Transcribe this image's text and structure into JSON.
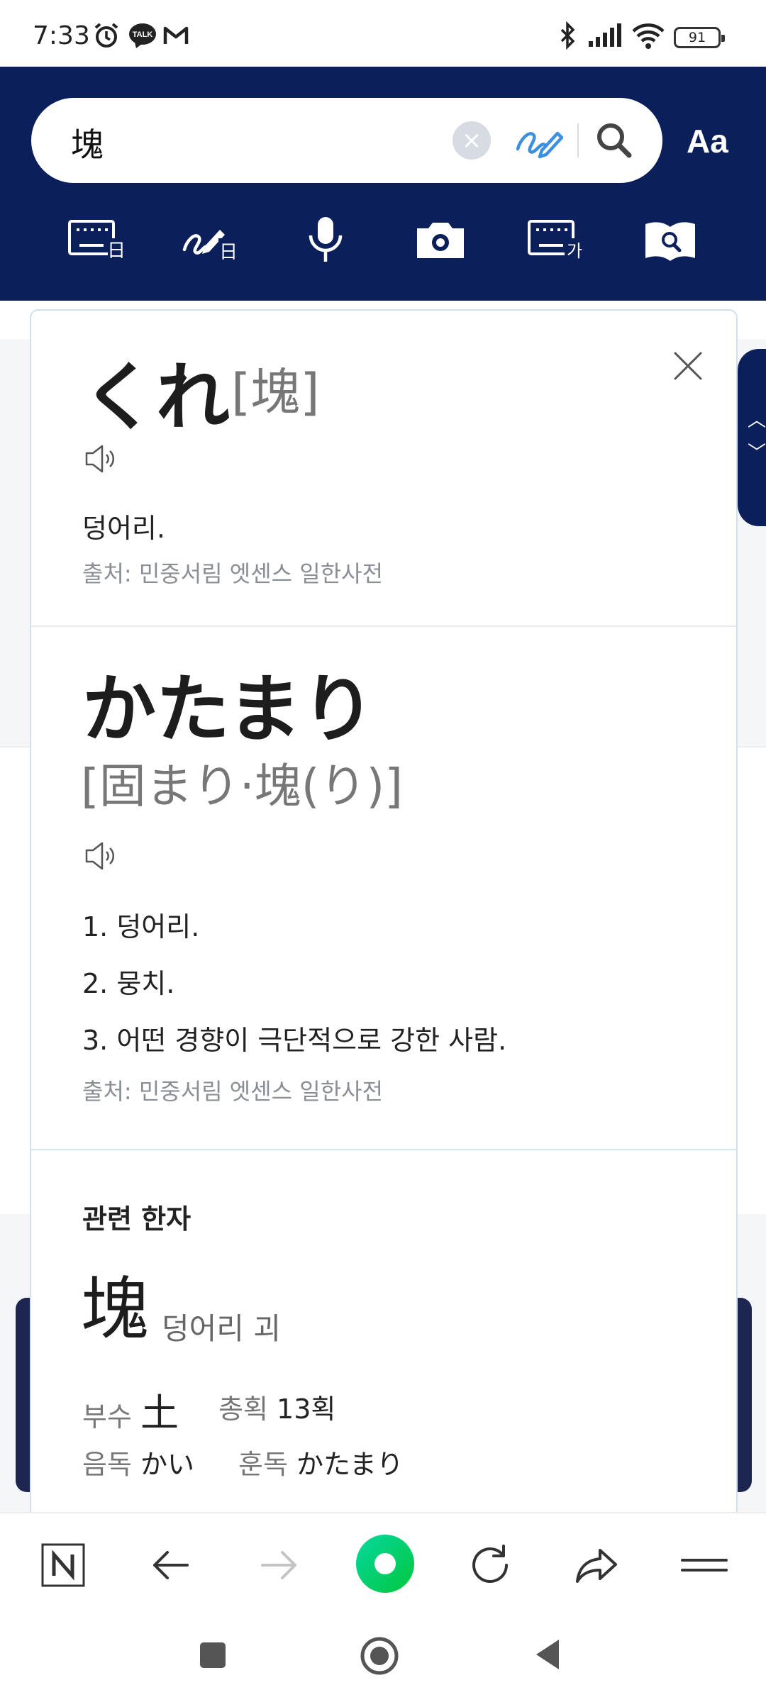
{
  "status_bar": {
    "time": "7:33",
    "battery": "91"
  },
  "search": {
    "query": "塊",
    "font_button": "Aa"
  },
  "entries": [
    {
      "headword": "くれ",
      "kanji": "[塊]",
      "definition": "덩어리.",
      "source": "출처: 민중서림 엣센스 일한사전"
    },
    {
      "headword": "かたまり",
      "kanji": "[固まり·塊(り)]",
      "definitions": [
        "1. 덩어리.",
        "2. 뭉치.",
        "3. 어떤 경향이 극단적으로 강한 사람."
      ],
      "source": "출처: 민중서림 엣센스 일한사전"
    }
  ],
  "related_hanja": {
    "title": "관련 한자",
    "character": "塊",
    "meaning": "덩어리 괴",
    "radical_label": "부수",
    "radical": "土",
    "strokes_label": "총획",
    "strokes": "13획",
    "on_label": "음독",
    "on": "かい",
    "kun_label": "훈독",
    "kun": "かたまり"
  },
  "colors": {
    "header": "#0b205a",
    "accent_green": "#03c75a",
    "clear_grey": "#d7dbe2",
    "handwrite_blue": "#3d8fe0"
  }
}
